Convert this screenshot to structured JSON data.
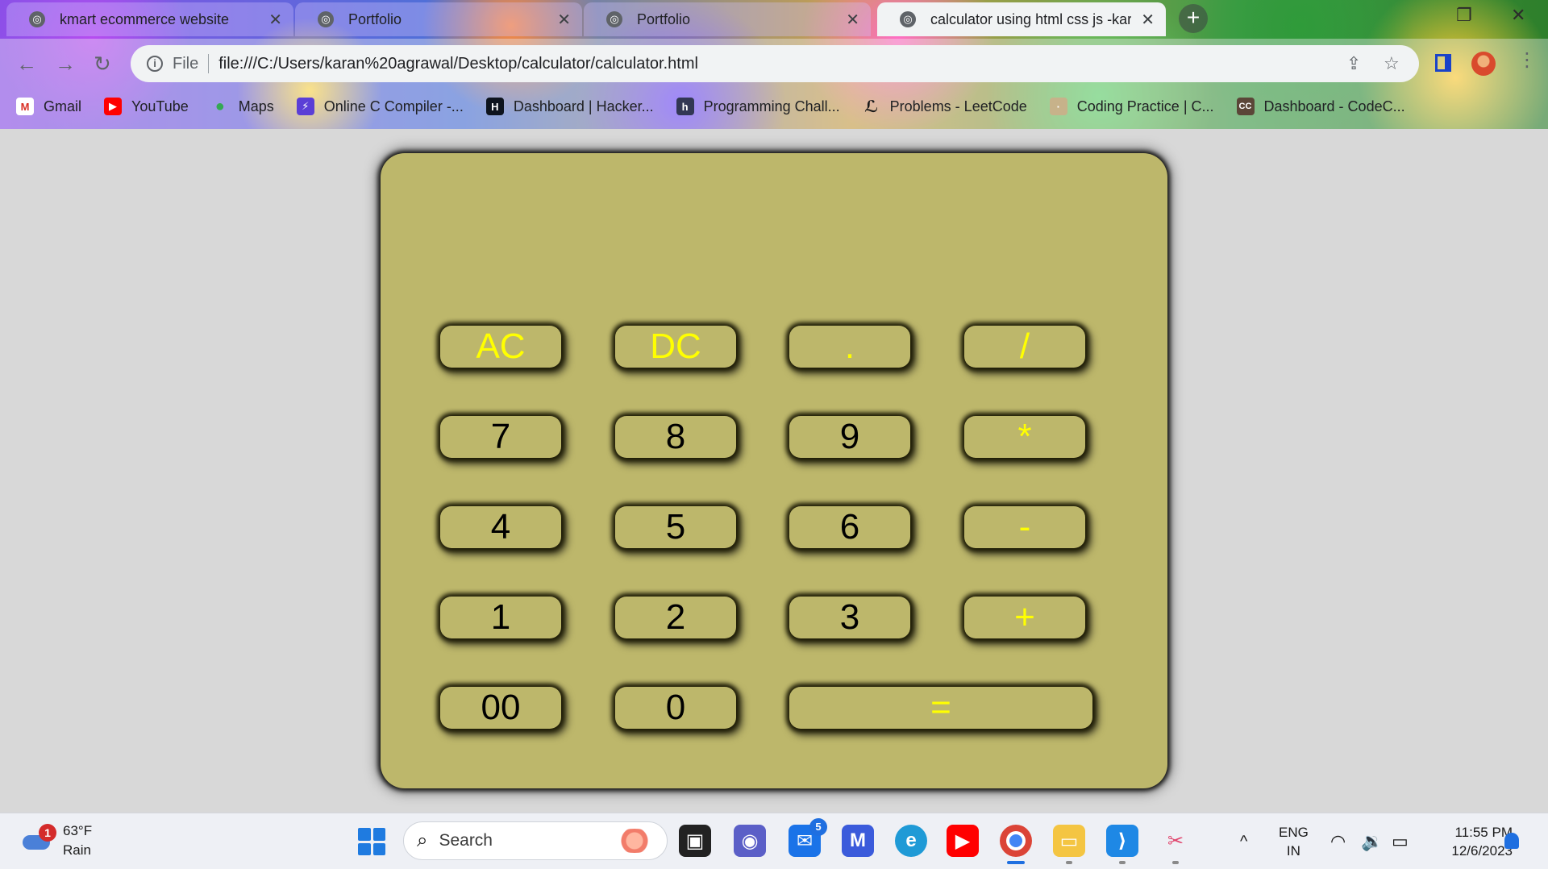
{
  "browser": {
    "tabs": [
      {
        "title": "kmart ecommerce website",
        "active": false
      },
      {
        "title": "Portfolio",
        "active": false
      },
      {
        "title": "Portfolio",
        "active": false
      },
      {
        "title": "calculator using html css js -kara",
        "active": true
      }
    ],
    "new_tab": "+",
    "address": {
      "scheme_label": "File",
      "url": "file:///C:/Users/karan%20agrawal/Desktop/calculator/calculator.html"
    },
    "bookmarks": [
      {
        "label": "Gmail",
        "icon": "gmail-icon",
        "color": "#d93025",
        "glyph": "M"
      },
      {
        "label": "YouTube",
        "icon": "youtube-icon",
        "color": "#ff0000",
        "glyph": "▶"
      },
      {
        "label": "Maps",
        "icon": "maps-icon",
        "color": "#34a853",
        "glyph": "●"
      },
      {
        "label": "Online C Compiler -...",
        "icon": "compiler-icon",
        "color": "#5b3fd6",
        "glyph": "⚡"
      },
      {
        "label": "Dashboard | Hacker...",
        "icon": "hackerrank-icon",
        "color": "#0e141e",
        "glyph": "H"
      },
      {
        "label": "Programming Chall...",
        "icon": "hackerearth-icon",
        "color": "#323754",
        "glyph": "h"
      },
      {
        "label": "Problems - LeetCode",
        "icon": "leetcode-icon",
        "color": "#ffa116",
        "glyph": "L"
      },
      {
        "label": "Coding Practice | C...",
        "icon": "codingpractice-icon",
        "color": "#c7b28a",
        "glyph": "·"
      },
      {
        "label": "Dashboard - CodeC...",
        "icon": "codechef-icon",
        "color": "#5b4638",
        "glyph": "CC"
      }
    ]
  },
  "calculator": {
    "display_value": "",
    "keys": [
      [
        "AC",
        "DC",
        ".",
        "/"
      ],
      [
        "7",
        "8",
        "9",
        "*"
      ],
      [
        "4",
        "5",
        "6",
        "-"
      ],
      [
        "1",
        "2",
        "3",
        "+"
      ],
      [
        "00",
        "0",
        "="
      ]
    ],
    "colors": {
      "body": "#bdb76b",
      "operator_text": "#ffff00",
      "digit_text": "#000000"
    }
  },
  "taskbar": {
    "weather": {
      "badge": "1",
      "temp": "63°F",
      "condition": "Rain"
    },
    "search_label": "Search",
    "mail_badge": "5",
    "language": {
      "line1": "ENG",
      "line2": "IN"
    },
    "time": "11:55 PM",
    "date": "12/6/2023"
  }
}
